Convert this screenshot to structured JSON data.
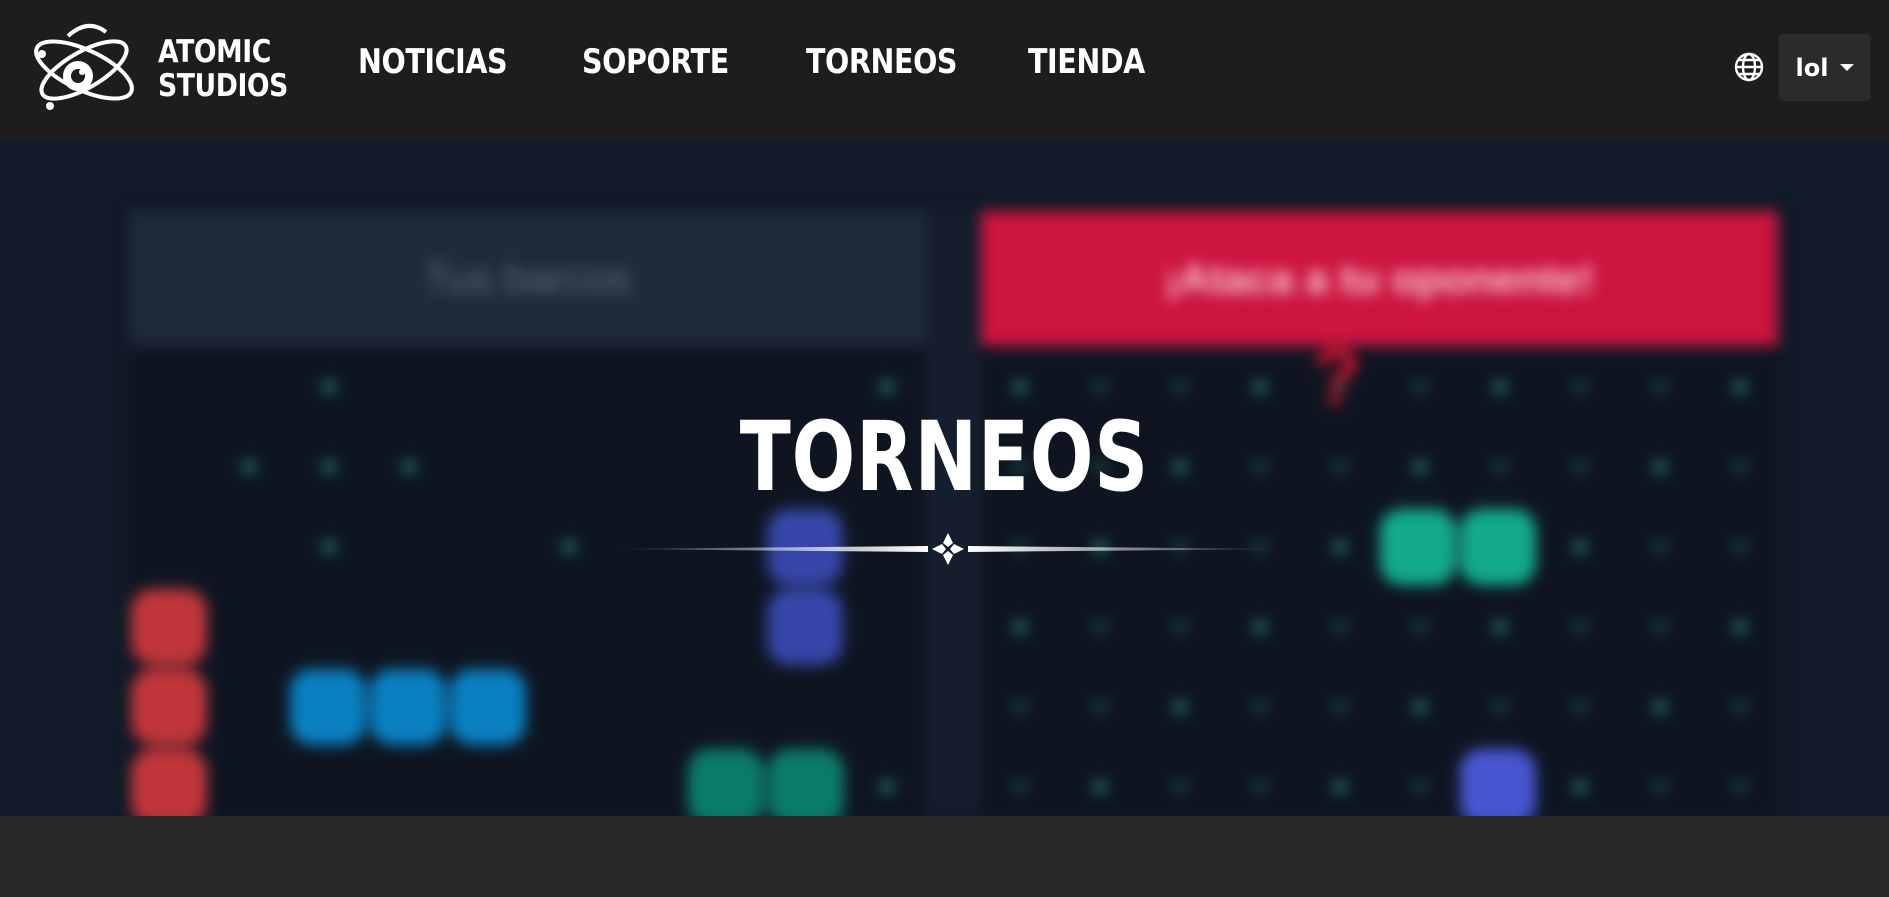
{
  "brand": {
    "line1": "ATOMIC",
    "line2": "STUDIOS",
    "logo_icon": "atom-logo-icon"
  },
  "nav": {
    "links": [
      {
        "label": "NOTICIAS"
      },
      {
        "label": "SOPORTE"
      },
      {
        "label": "TORNEOS"
      },
      {
        "label": "TIENDA"
      }
    ],
    "language_icon": "globe-icon",
    "user_menu_label": "lol"
  },
  "background_game": {
    "left_header": "Tus barcos",
    "right_header": "¡Ataca a tu oponente!",
    "unknown_marker": "?"
  },
  "hero": {
    "title": "TORNEOS"
  },
  "colors": {
    "navbar_bg": "#1e1c1e",
    "hero_bg": "#111a28",
    "attack_red": "#cc1540",
    "footer_bg": "#2a282b"
  }
}
